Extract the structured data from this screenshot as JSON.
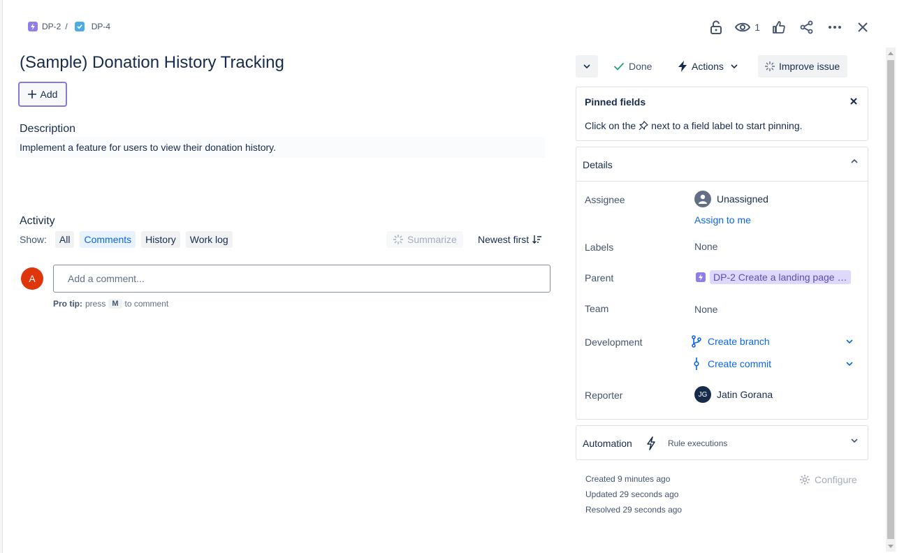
{
  "breadcrumb": {
    "parent_key": "DP-2",
    "separator": "/",
    "current_key": "DP-4"
  },
  "header": {
    "watch_count": "1"
  },
  "issue": {
    "title": "(Sample) Donation History Tracking",
    "add_label": "Add",
    "description_heading": "Description",
    "description": "Implement a feature for users to view their donation history."
  },
  "activity": {
    "heading": "Activity",
    "show_label": "Show:",
    "filters": [
      "All",
      "Comments",
      "History",
      "Work log"
    ],
    "active_filter": "Comments",
    "summarize_label": "Summarize",
    "sort_label": "Newest first",
    "avatar_initial": "A",
    "comment_placeholder": "Add a comment...",
    "protip_prefix": "Pro tip:",
    "protip_press": "press",
    "protip_key": "M",
    "protip_suffix": "to comment"
  },
  "status_bar": {
    "status": "Done",
    "actions_label": "Actions",
    "improve_label": "Improve issue"
  },
  "pinned": {
    "heading": "Pinned fields",
    "text_before": "Click on the",
    "text_after": "next to a field label to start pinning."
  },
  "details": {
    "heading": "Details",
    "assignee_label": "Assignee",
    "assignee_value": "Unassigned",
    "assign_to_me": "Assign to me",
    "labels_label": "Labels",
    "labels_value": "None",
    "parent_label": "Parent",
    "parent_value": "DP-2 Create a landing page f...",
    "team_label": "Team",
    "team_value": "None",
    "development_label": "Development",
    "create_branch": "Create branch",
    "create_commit": "Create commit",
    "reporter_label": "Reporter",
    "reporter_initials": "JG",
    "reporter_name": "Jatin Gorana"
  },
  "automation": {
    "heading": "Automation",
    "rule_executions": "Rule executions"
  },
  "meta": {
    "created": "Created 9 minutes ago",
    "updated": "Updated 29 seconds ago",
    "resolved": "Resolved 29 seconds ago",
    "configure_label": "Configure"
  },
  "colors": {
    "accent": "#0c66e4",
    "epic_purple": "#8f7ee7",
    "task_blue": "#4bade8",
    "avatar_red": "#de350b",
    "done_green": "#22a06b"
  }
}
